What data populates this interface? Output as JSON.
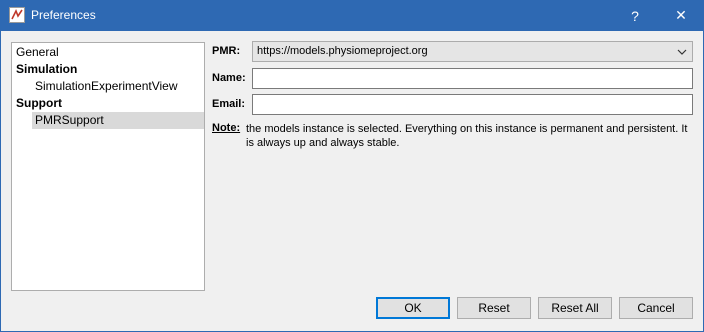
{
  "window": {
    "title": "Preferences",
    "help_glyph": "?",
    "close_glyph": "✕"
  },
  "tree": {
    "items": [
      {
        "label": "General",
        "kind": "category-plain"
      },
      {
        "label": "Simulation",
        "kind": "category"
      },
      {
        "label": "SimulationExperimentView",
        "kind": "child"
      },
      {
        "label": "Support",
        "kind": "category"
      },
      {
        "label": "PMRSupport",
        "kind": "child",
        "selected": true
      }
    ]
  },
  "form": {
    "pmr_label": "PMR:",
    "pmr_value": "https://models.physiomeproject.org",
    "name_label": "Name:",
    "name_value": "",
    "email_label": "Email:",
    "email_value": "",
    "note_label": "Note:",
    "note_text": "the models instance is selected. Everything on this instance is permanent and persistent. It is always up and always stable."
  },
  "buttons": {
    "ok": "OK",
    "reset": "Reset",
    "reset_all": "Reset All",
    "cancel": "Cancel"
  },
  "colors": {
    "titlebar": "#2e69b3",
    "selection": "#d9d9d9",
    "default_button_border": "#0078d7"
  },
  "icons": {
    "app": "opencor-app-icon",
    "dropdown": "chevron-down-icon"
  }
}
